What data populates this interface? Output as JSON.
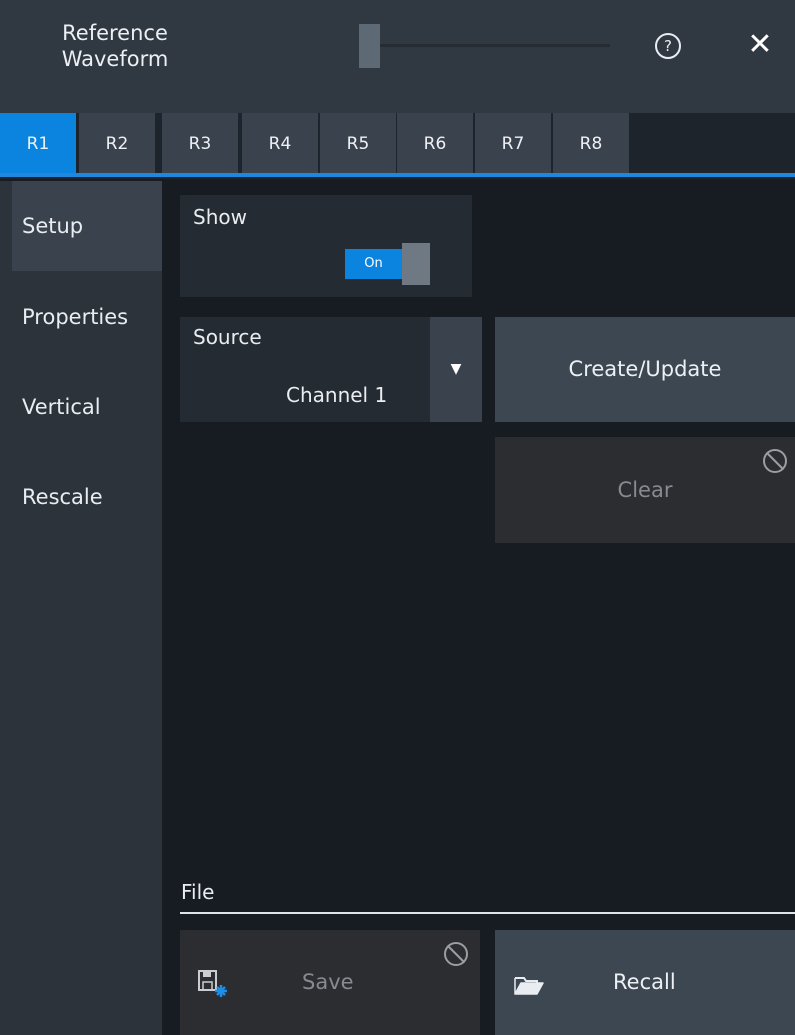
{
  "window": {
    "title_line1": "Reference",
    "title_line2": "Waveform",
    "help_glyph": "?",
    "close_glyph": "✕"
  },
  "tabs": [
    {
      "label": "R1",
      "active": true
    },
    {
      "label": "R2"
    },
    {
      "label": "R3"
    },
    {
      "label": "R4"
    },
    {
      "label": "R5"
    },
    {
      "label": "R6"
    },
    {
      "label": "R7"
    },
    {
      "label": "R8"
    }
  ],
  "sidebar": {
    "items": [
      {
        "label": "Setup",
        "active": true
      },
      {
        "label": "Properties"
      },
      {
        "label": "Vertical"
      },
      {
        "label": "Rescale"
      }
    ]
  },
  "setup": {
    "show_label": "Show",
    "show_toggle_text": "On",
    "source_label": "Source",
    "source_value": "Channel 1",
    "create_update_label": "Create/Update",
    "clear_label": "Clear",
    "file_label": "File",
    "save_label": "Save",
    "recall_label": "Recall"
  },
  "colors": {
    "accent": "#0b84e0",
    "background": "#171c22",
    "panel": "#252b32",
    "button": "#3d4752",
    "disabled": "#2b2d30"
  },
  "icons": {
    "help": "help-circle-icon",
    "close": "close-icon",
    "dropdown": "triangle-down-icon",
    "disabled": "no-entry-icon",
    "save": "floppy-disk-icon",
    "recall": "folder-open-icon"
  }
}
